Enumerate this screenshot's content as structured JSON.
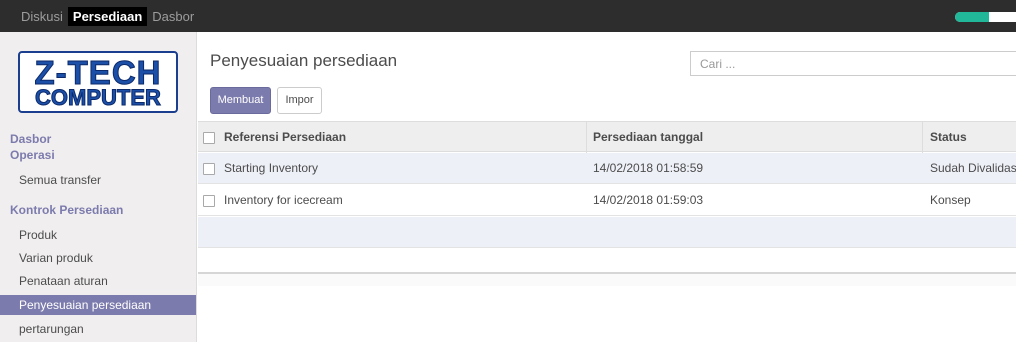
{
  "topbar": {
    "menu": [
      "Diskusi",
      "Persediaan",
      "Dasbor"
    ],
    "active": "Persediaan"
  },
  "logo": {
    "line1": "Z-TECH",
    "line2": "COMPUTER"
  },
  "sidebar": {
    "dasbor": "Dasbor",
    "operasi": "Operasi",
    "semua_transfer": "Semua transfer",
    "kontrol_header": "Kontrok Persediaan",
    "items": [
      "Produk",
      "Varian produk",
      "Penataan aturan",
      "Penyesuaian persediaan",
      "pertarungan"
    ],
    "active_item": "Penyesuaian persediaan"
  },
  "main": {
    "title": "Penyesuaian persediaan",
    "search_placeholder": "Cari ...",
    "create_label": "Membuat",
    "import_label": "Impor"
  },
  "table": {
    "columns": [
      "Referensi Persediaan",
      "Persediaan tanggal",
      "Status"
    ],
    "rows": [
      [
        "Starting Inventory",
        "14/02/2018 01:58:59",
        "Sudah Divalidasi"
      ],
      [
        "Inventory for icecream",
        "14/02/2018 01:59:03",
        "Konsep"
      ]
    ]
  },
  "colors": {
    "accent": "#7c7bad",
    "topbar": "#2d2d2d",
    "progress": "#21b799"
  },
  "progress_fraction": 0.55
}
